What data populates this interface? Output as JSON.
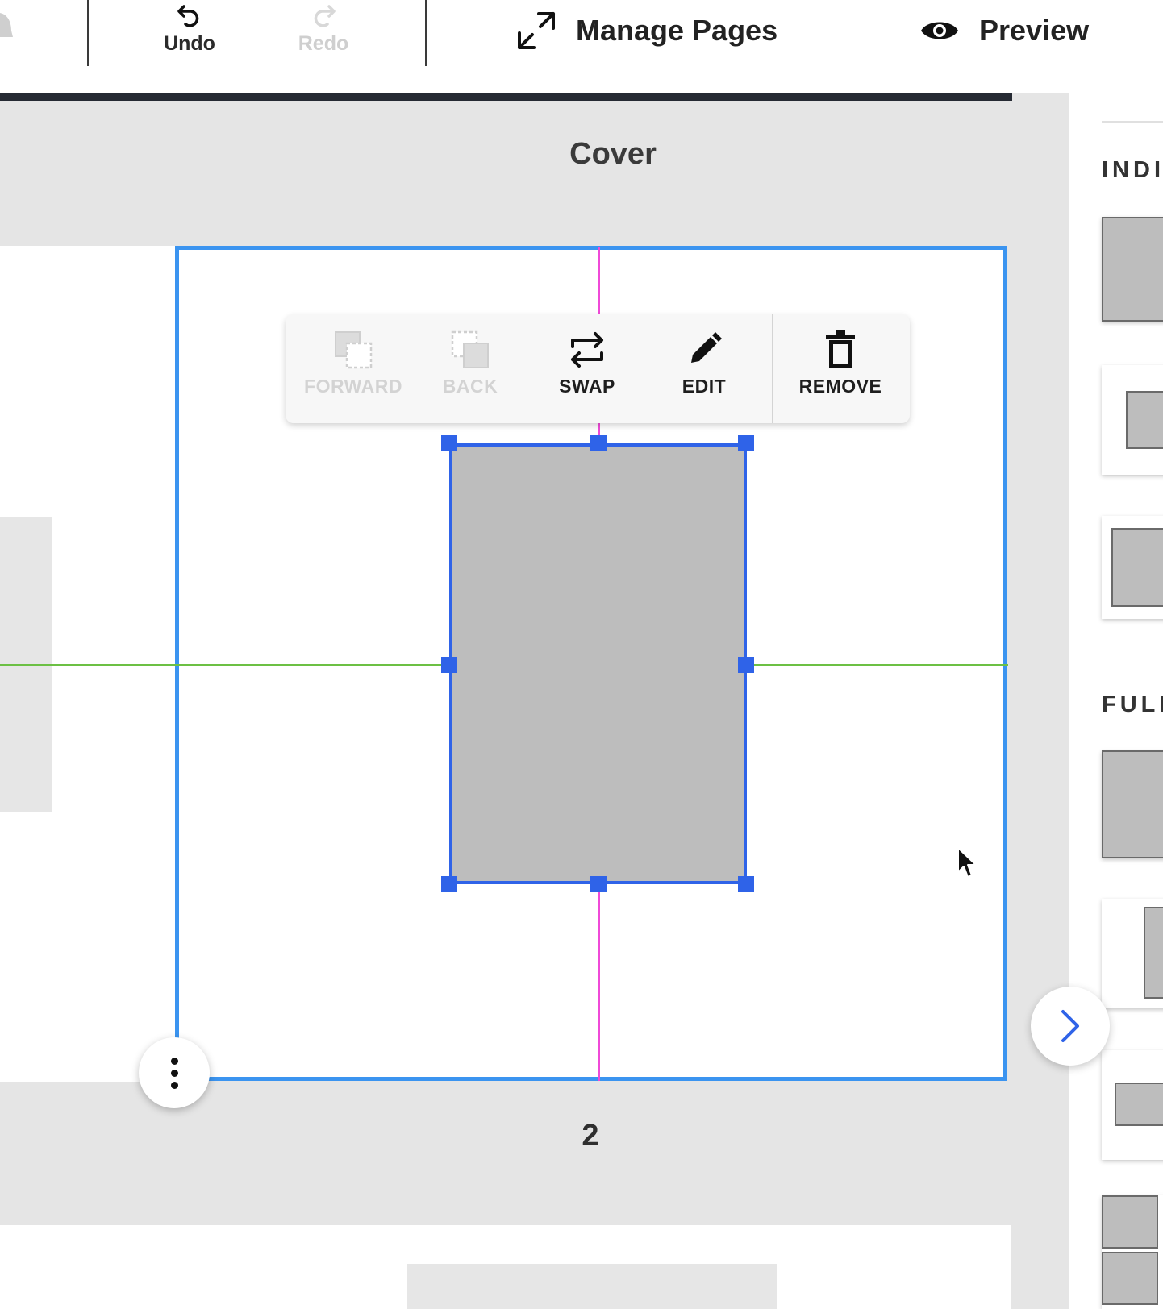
{
  "toolbar": {
    "undo_label": "Undo",
    "redo_label": "Redo",
    "manage_pages_label": "Manage Pages",
    "preview_label": "Preview"
  },
  "canvas": {
    "section_title": "Cover",
    "page_number": "2"
  },
  "element_toolbar": {
    "forward_label": "FORWARD",
    "back_label": "BACK",
    "swap_label": "SWAP",
    "edit_label": "EDIT",
    "remove_label": "REMOVE"
  },
  "right_panel": {
    "section_1": "INDI",
    "section_2": "FULL"
  },
  "colors": {
    "selection_blue": "#3b94f0",
    "handle_blue": "#2f63e8",
    "vertical_guide": "#f04ad8",
    "horizontal_guide": "#6cc044",
    "placeholder_gray": "#bdbdbd"
  },
  "icons": [
    "bell-icon",
    "undo-icon",
    "redo-icon",
    "expand-icon",
    "eye-icon",
    "forward-icon",
    "back-icon",
    "swap-icon",
    "pencil-icon",
    "trash-icon",
    "more-vertical-icon",
    "chevron-right-icon",
    "cursor-icon"
  ]
}
